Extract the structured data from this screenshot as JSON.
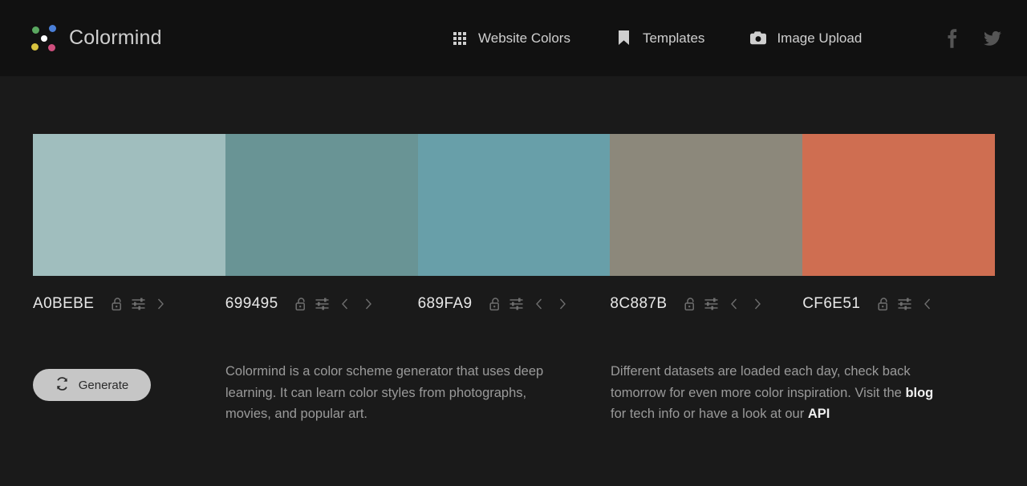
{
  "site": {
    "brand_name": "Colormind",
    "logo_dots": {
      "top_left": "#5aa860",
      "top_right": "#4a7fd8",
      "bottom_left": "#d8c33f",
      "bottom_right": "#cf4f7e",
      "center": "#ffffff"
    }
  },
  "header": {
    "background": "#111111",
    "nav": [
      {
        "label": "Website Colors",
        "icon": "grid-icon"
      },
      {
        "label": "Templates",
        "icon": "bookmark-icon"
      },
      {
        "label": "Image Upload",
        "icon": "camera-icon"
      }
    ],
    "social": [
      {
        "name": "facebook",
        "label": "f"
      },
      {
        "name": "twitter",
        "label": ""
      }
    ]
  },
  "palette": {
    "swatches": [
      {
        "hex": "A0BEBE",
        "color": "#A0BEBE",
        "locked": false,
        "lock_icon": "unlock-icon",
        "adjust_icon": "sliders-icon",
        "has_prev": false,
        "has_next": true
      },
      {
        "hex": "699495",
        "color": "#699495",
        "locked": false,
        "lock_icon": "unlock-icon",
        "adjust_icon": "sliders-icon",
        "has_prev": true,
        "has_next": true
      },
      {
        "hex": "689FA9",
        "color": "#689FA9",
        "locked": false,
        "lock_icon": "unlock-icon",
        "adjust_icon": "sliders-icon",
        "has_prev": true,
        "has_next": true
      },
      {
        "hex": "8C887B",
        "color": "#8C887B",
        "locked": false,
        "lock_icon": "unlock-icon",
        "adjust_icon": "sliders-icon",
        "has_prev": true,
        "has_next": true
      },
      {
        "hex": "CF6E51",
        "color": "#CF6E51",
        "locked": false,
        "lock_icon": "unlock-icon",
        "adjust_icon": "sliders-icon",
        "has_prev": true,
        "has_next": false
      }
    ]
  },
  "actions": {
    "generate_label": "Generate",
    "generate_icon": "refresh-icon",
    "generate_bg": "#c6c6c6"
  },
  "info": {
    "column_one": "Colormind is a color scheme generator that uses deep learning. It can learn color styles from photographs, movies, and popular art.",
    "column_two_part_one": "Different datasets are loaded each day, check back tomorrow for even more color inspiration. Visit the ",
    "column_two_link_blog": "blog",
    "column_two_part_two": " for tech info or have a look at our ",
    "column_two_link_api": "API"
  }
}
